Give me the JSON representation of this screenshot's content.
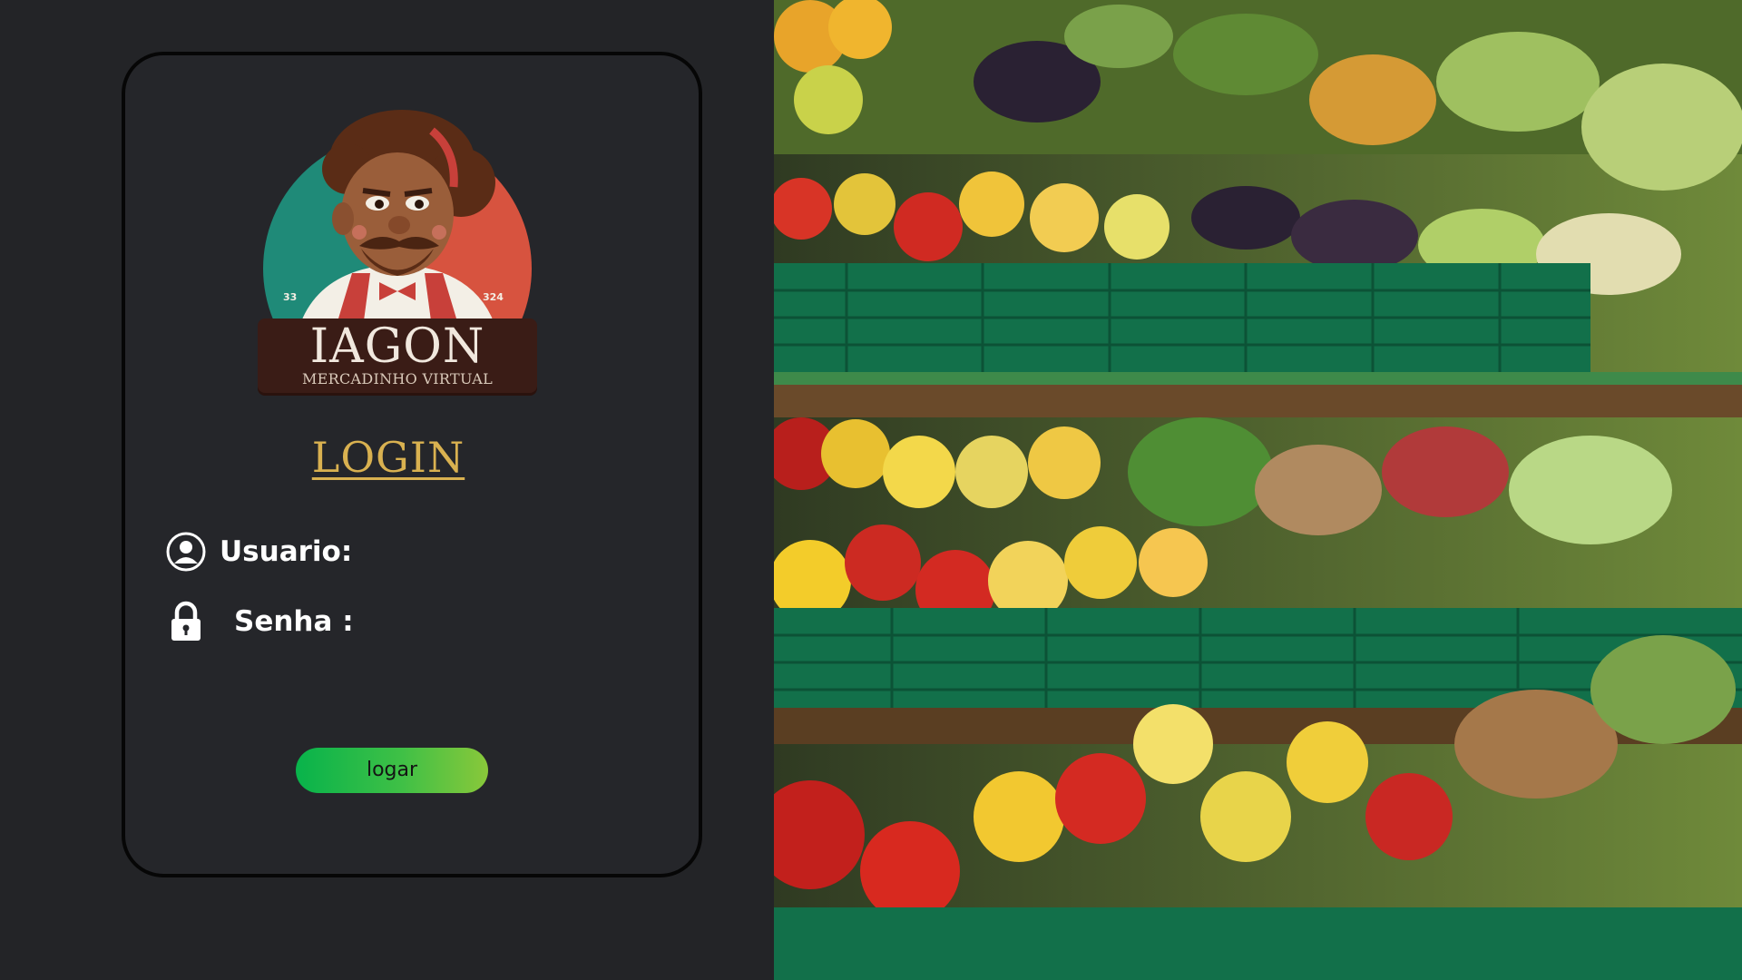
{
  "brand": {
    "name": "IAGON",
    "tagline": "MERCADINHO VIRTUAL",
    "badge_left": "33",
    "badge_right": "324"
  },
  "login": {
    "title": "LOGIN",
    "user_label": "Usuario:",
    "user_value": "",
    "password_label": "Senha :",
    "password_value": "",
    "submit_label": "logar"
  },
  "colors": {
    "background": "#232427",
    "title_gold": "#d9b150",
    "button_green": "#08b34b",
    "crate_green": "#15784a"
  },
  "icons": {
    "user": "user-circle-icon",
    "password": "lock-icon"
  }
}
